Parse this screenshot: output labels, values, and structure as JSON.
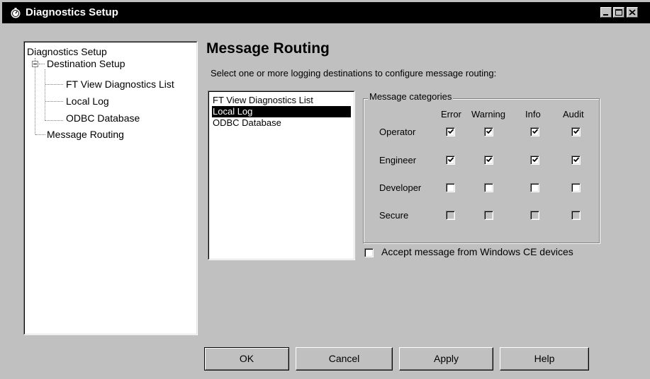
{
  "window": {
    "title": "Diagnostics Setup"
  },
  "tree": {
    "root": "Diagnostics Setup",
    "destination_setup": "Destination Setup",
    "children": [
      "FT View Diagnostics List",
      "Local Log",
      "ODBC Database"
    ],
    "message_routing": "Message Routing"
  },
  "main": {
    "heading": "Message Routing",
    "instruction": "Select one or more logging destinations to configure message routing:"
  },
  "destinations": {
    "items": [
      "FT View Diagnostics List",
      "Local Log",
      "ODBC Database"
    ],
    "selected": "Local Log"
  },
  "categories": {
    "legend": "Message categories",
    "columns": [
      "Error",
      "Warning",
      "Info",
      "Audit"
    ],
    "rows": [
      {
        "label": "Operator",
        "checked": [
          true,
          true,
          true,
          true
        ],
        "enabled": true
      },
      {
        "label": "Engineer",
        "checked": [
          true,
          true,
          true,
          true
        ],
        "enabled": true
      },
      {
        "label": "Developer",
        "checked": [
          false,
          false,
          false,
          false
        ],
        "enabled": true
      },
      {
        "label": "Secure",
        "checked": [
          false,
          false,
          false,
          false
        ],
        "enabled": false
      }
    ]
  },
  "accept_ce": {
    "label": "Accept message from Windows CE devices",
    "checked": false
  },
  "buttons": {
    "ok": "OK",
    "cancel": "Cancel",
    "apply": "Apply",
    "help": "Help"
  },
  "icons": {
    "app": "stopwatch-icon",
    "minimize": "minimize-icon",
    "maximize": "maximize-icon",
    "close": "close-icon",
    "checkmark": "checkmark-icon"
  }
}
